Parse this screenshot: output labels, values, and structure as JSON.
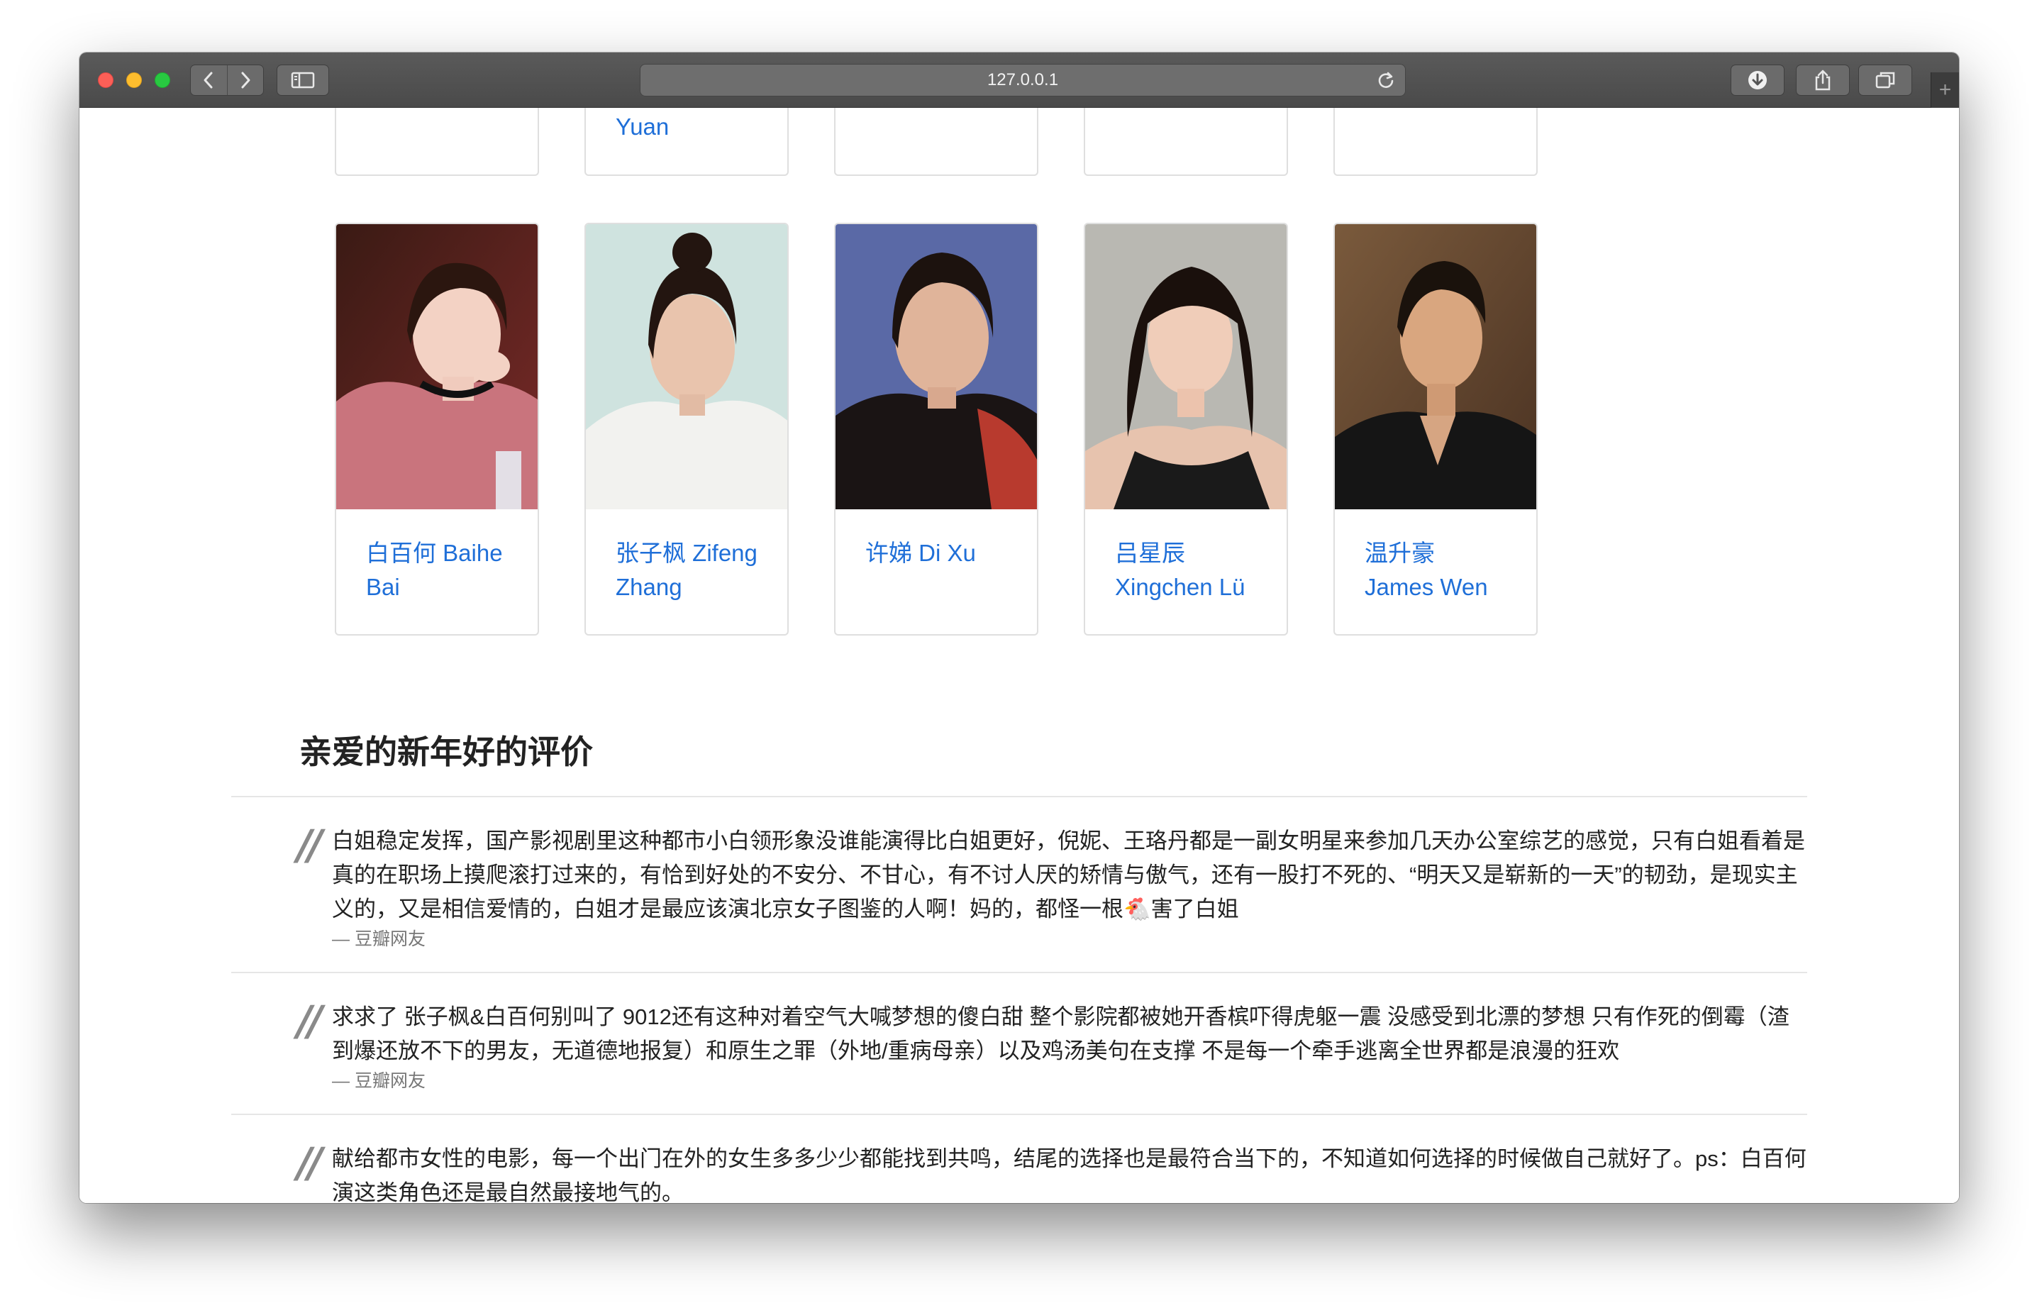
{
  "browser": {
    "url": "127.0.0.1"
  },
  "top_row": {
    "visible_names": [
      "",
      "Yuan",
      "",
      "",
      ""
    ]
  },
  "cast": [
    {
      "name": "白百何 Baihe Bai",
      "photo": "portrait-baihe-bai"
    },
    {
      "name": "张子枫 Zifeng Zhang",
      "photo": "portrait-zifeng-zhang"
    },
    {
      "name": "许娣 Di Xu",
      "photo": "portrait-di-xu"
    },
    {
      "name": "吕星辰 Xingchen Lü",
      "photo": "portrait-xingchen-lu"
    },
    {
      "name": "温升豪 James Wen",
      "photo": "portrait-james-wen"
    }
  ],
  "reviews_section": {
    "title": "亲爱的新年好的评价",
    "items": [
      {
        "text": "白姐稳定发挥，国产影视剧里这种都市小白领形象没谁能演得比白姐更好，倪妮、王珞丹都是一副女明星来参加几天办公室综艺的感觉，只有白姐看着是真的在职场上摸爬滚打过来的，有恰到好处的不安分、不甘心，有不讨人厌的矫情与傲气，还有一股打不死的、“明天又是崭新的一天”的韧劲，是现实主义的，又是相信爱情的，白姐才是最应该演北京女子图鉴的人啊！妈的，都怪一根🐔害了白姐",
        "author": "— 豆瓣网友"
      },
      {
        "text": "求求了 张子枫&白百何别叫了 9012还有这种对着空气大喊梦想的傻白甜 整个影院都被她开香槟吓得虎躯一震 没感受到北漂的梦想 只有作死的倒霉（渣到爆还放不下的男友，无道德地报复）和原生之罪（外地/重病母亲）以及鸡汤美句在支撑 不是每一个牵手逃离全世界都是浪漫的狂欢",
        "author": "— 豆瓣网友"
      },
      {
        "text": "献给都市女性的电影，每一个出门在外的女生多多少少都能找到共鸣，结尾的选择也是最符合当下的，不知道如何选择的时候做自己就好了。ps：白百何演这类角色还是最自然最接地气的。",
        "author": ""
      }
    ]
  }
}
